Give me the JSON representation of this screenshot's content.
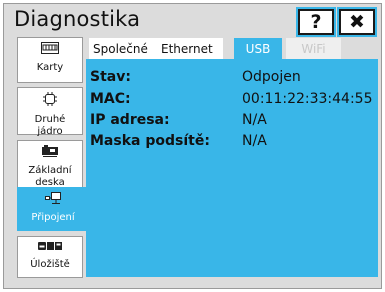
{
  "window": {
    "title": "Diagnostika",
    "help_label": "?",
    "close_label": "✖"
  },
  "sidebar": {
    "items": [
      {
        "label": "Karty",
        "icon": "card-icon",
        "active": false
      },
      {
        "label": "Druhé jádro",
        "icon": "chip-icon",
        "active": false
      },
      {
        "label": "Základní deska",
        "icon": "motherboard-icon",
        "active": false
      },
      {
        "label": "Připojení",
        "icon": "connection-icon",
        "active": true
      },
      {
        "label": "Úložiště",
        "icon": "storage-icon",
        "active": false
      }
    ]
  },
  "tabs": [
    {
      "label": "Společné",
      "active": false,
      "enabled": true
    },
    {
      "label": "Ethernet",
      "active": false,
      "enabled": true
    },
    {
      "label": "USB",
      "active": true,
      "enabled": true
    },
    {
      "label": "WiFi",
      "active": false,
      "enabled": false
    }
  ],
  "details": [
    {
      "label": "Stav:",
      "value": "Odpojen"
    },
    {
      "label": "MAC:",
      "value": "00:11:22:33:44:55"
    },
    {
      "label": "IP adresa:",
      "value": "N/A"
    },
    {
      "label": "Maska podsítě:",
      "value": "N/A"
    }
  ],
  "colors": {
    "accent": "#39b6e8",
    "background": "#dcdcdc"
  }
}
